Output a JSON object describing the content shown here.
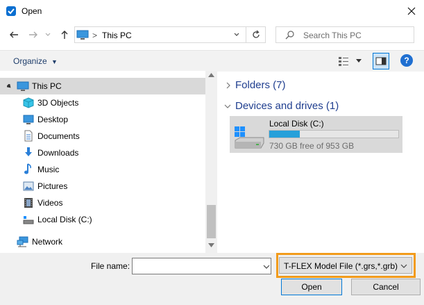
{
  "window": {
    "title": "Open"
  },
  "address": {
    "location": "This PC",
    "separator": ">"
  },
  "search": {
    "placeholder": "Search This PC"
  },
  "toolbar": {
    "organize_label": "Organize",
    "help_label": "?"
  },
  "nav": {
    "items": [
      {
        "label": "This PC",
        "icon": "computer-icon",
        "selected": true
      },
      {
        "label": "3D Objects",
        "icon": "cube-icon"
      },
      {
        "label": "Desktop",
        "icon": "desktop-icon"
      },
      {
        "label": "Documents",
        "icon": "documents-icon"
      },
      {
        "label": "Downloads",
        "icon": "download-icon"
      },
      {
        "label": "Music",
        "icon": "music-icon"
      },
      {
        "label": "Pictures",
        "icon": "pictures-icon"
      },
      {
        "label": "Videos",
        "icon": "video-icon"
      },
      {
        "label": "Local Disk (C:)",
        "icon": "drive-icon"
      },
      {
        "label": "Network",
        "icon": "network-icon"
      }
    ]
  },
  "content": {
    "folders_header": "Folders (7)",
    "devices_header": "Devices and drives (1)",
    "drive": {
      "name": "Local Disk (C:)",
      "free_text": "730 GB free of 953 GB",
      "used_fraction": 0.234
    }
  },
  "bottom": {
    "file_name_label": "File name:",
    "file_name_value": "",
    "filter_value": "T-FLEX Model File (*.grs,*.grb)",
    "open_label": "Open",
    "cancel_label": "Cancel"
  },
  "colors": {
    "accent": "#0078d7",
    "highlight": "#f29b1b",
    "progress": "#26a0da"
  }
}
